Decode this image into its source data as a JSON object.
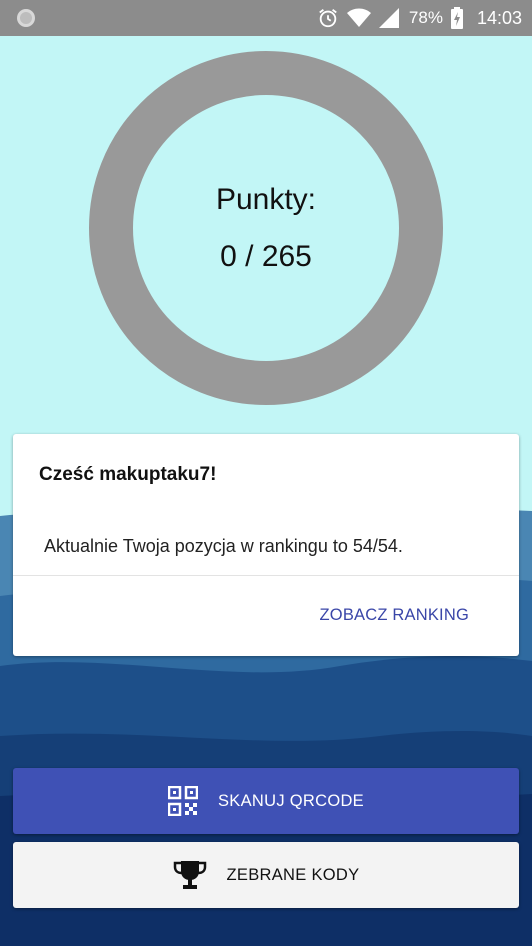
{
  "status_bar": {
    "battery": "78%",
    "time": "14:03"
  },
  "points": {
    "label": "Punkty:",
    "value": "0 / 265",
    "earned": 0,
    "total": 265
  },
  "card": {
    "title": "Cześć makuptaku7!",
    "body": "Aktualnie Twoja pozycja w rankingu to 54/54.",
    "action_label": "ZOBACZ RANKING"
  },
  "buttons": {
    "scan_label": "SKANUJ QRCODE",
    "codes_label": "ZEBRANE KODY"
  },
  "icons": {
    "scan": "qr-code-icon",
    "codes": "trophy-icon"
  },
  "colors": {
    "background": "#c2f6f6",
    "ring": "#999999",
    "primary": "#3f51b5",
    "action_text": "#3a46a8"
  }
}
